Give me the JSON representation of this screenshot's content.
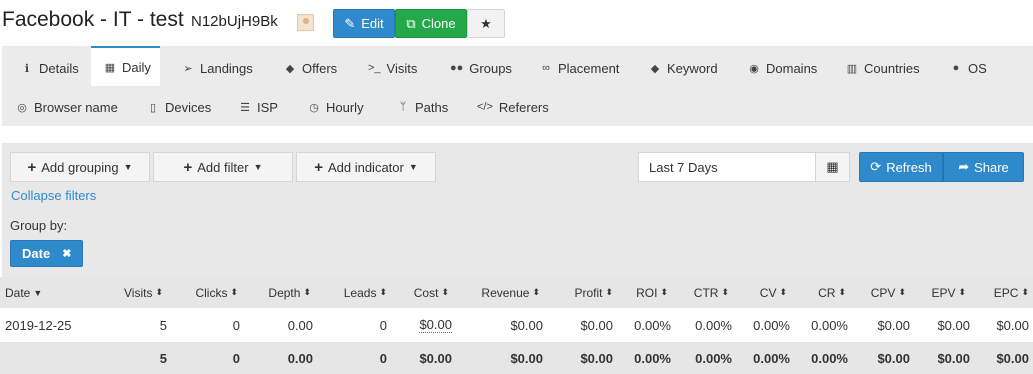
{
  "header": {
    "title": "Facebook - IT - test",
    "campaign_id": "N12bUjH9Bk",
    "edit_label": "Edit",
    "clone_label": "Clone"
  },
  "tabs": [
    {
      "label": "Details",
      "icon": "info-icon",
      "active": false
    },
    {
      "label": "Daily",
      "icon": "calendar-icon",
      "active": true
    },
    {
      "label": "Landings",
      "icon": "paper-plane-icon",
      "active": false
    },
    {
      "label": "Offers",
      "icon": "tag-icon",
      "active": false
    },
    {
      "label": "Visits",
      "icon": "terminal-icon",
      "active": false
    },
    {
      "label": "Groups",
      "icon": "users-icon",
      "active": false
    },
    {
      "label": "Placement",
      "icon": "link-icon",
      "active": false
    },
    {
      "label": "Keyword",
      "icon": "tags-icon",
      "active": false
    },
    {
      "label": "Domains",
      "icon": "globe-icon",
      "active": false
    },
    {
      "label": "Countries",
      "icon": "map-icon",
      "active": false
    },
    {
      "label": "OS",
      "icon": "apple-icon",
      "active": false
    },
    {
      "label": "Browser name",
      "icon": "chrome-icon",
      "active": false
    },
    {
      "label": "Devices",
      "icon": "mobile-icon",
      "active": false
    },
    {
      "label": "ISP",
      "icon": "server-icon",
      "active": false
    },
    {
      "label": "Hourly",
      "icon": "clock-icon",
      "active": false
    },
    {
      "label": "Paths",
      "icon": "fork-icon",
      "active": false
    },
    {
      "label": "Referers",
      "icon": "code-icon",
      "active": false
    }
  ],
  "filters": {
    "add_grouping": "Add grouping",
    "add_filter": "Add filter",
    "add_indicator": "Add indicator",
    "date_range": "Last 7 Days",
    "refresh": "Refresh",
    "share": "Share",
    "collapse": "Collapse filters",
    "group_by_label": "Group by:",
    "group_chip": "Date"
  },
  "table": {
    "columns": [
      "Date",
      "Visits",
      "Clicks",
      "Depth",
      "Leads",
      "Cost",
      "Revenue",
      "Profit",
      "ROI",
      "CTR",
      "CV",
      "CR",
      "CPV",
      "EPV",
      "EPC"
    ],
    "sorted_column": "Date",
    "rows": [
      [
        "2019-12-25",
        "5",
        "0",
        "0.00",
        "0",
        "$0.00",
        "$0.00",
        "$0.00",
        "0.00%",
        "0.00%",
        "0.00%",
        "0.00%",
        "$0.00",
        "$0.00",
        "$0.00"
      ]
    ],
    "totals": [
      "",
      "5",
      "0",
      "0.00",
      "0",
      "$0.00",
      "$0.00",
      "$0.00",
      "0.00%",
      "0.00%",
      "0.00%",
      "0.00%",
      "$0.00",
      "$0.00",
      "$0.00"
    ]
  },
  "colors": {
    "primary_blue": "#2e8acb",
    "clone_green": "#23a949",
    "tab_bar_bg": "#ebebeb",
    "panel_bg": "#e8e8e8"
  }
}
